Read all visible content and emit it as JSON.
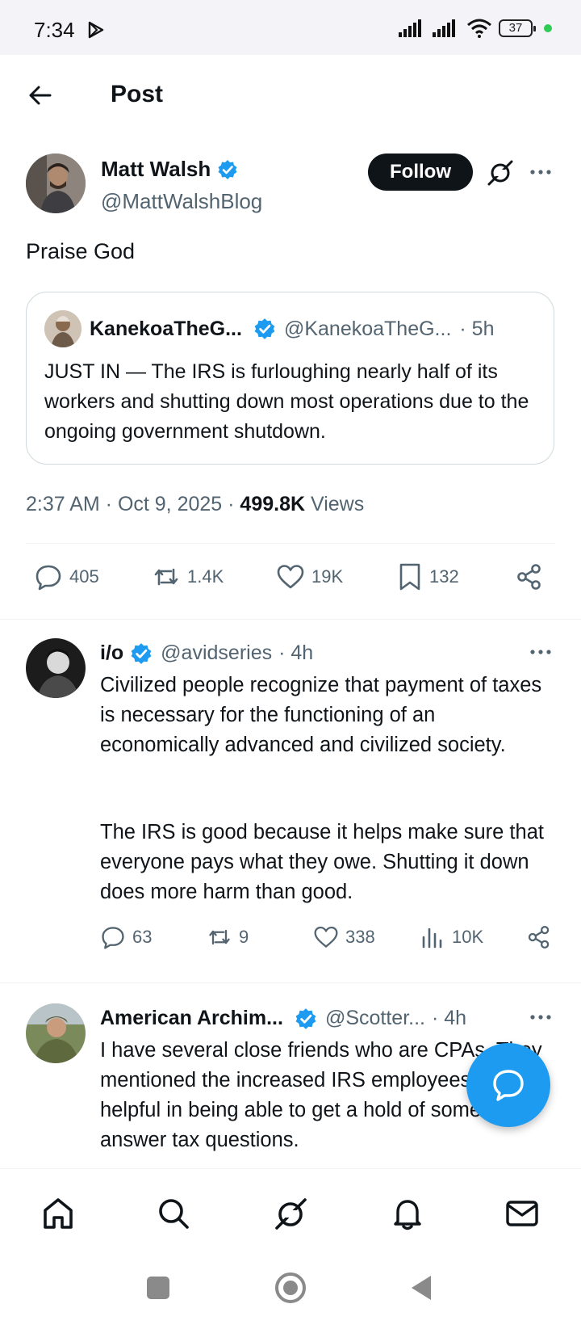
{
  "status_bar": {
    "time": "7:34",
    "battery": "37"
  },
  "header": {
    "title": "Post"
  },
  "main_tweet": {
    "author_name": "Matt Walsh",
    "handle": "@MattWalshBlog",
    "follow_label": "Follow",
    "text": "Praise God",
    "quote": {
      "author_name": "KanekoaTheG...",
      "handle": "@KanekoaTheG...",
      "time": "· 5h",
      "text": "JUST IN — The IRS is furloughing nearly half of its workers and shutting down most operations due to the ongoing government shutdown."
    },
    "timestamp": "2:37 AM · Oct 9, 2025 ·",
    "views_count": "499.8K",
    "views_label": "Views",
    "stats": {
      "replies": "405",
      "reposts": "1.4K",
      "likes": "19K",
      "bookmarks": "132"
    }
  },
  "replies": [
    {
      "author_name": "i/o",
      "handle": "@avidseries",
      "time": "· 4h",
      "text_p1": "Civilized people recognize that payment of taxes is necessary for the functioning of an economically advanced and civilized society.",
      "text_p2": "The IRS is good because it helps make sure that everyone pays what they owe. Shutting it down does more harm than good.",
      "stats": {
        "replies": "63",
        "reposts": "9",
        "likes": "338",
        "views": "10K"
      }
    },
    {
      "author_name": "American Archim...",
      "handle": "@Scotter...",
      "time": "· 4h",
      "text": "I have several close friends who are CPAs. They mentioned the increased IRS employees were helpful in being able to get a hold of someone to answer tax questions."
    }
  ],
  "icons": {
    "back": "arrow-left-icon",
    "grok": "grok-icon",
    "more": "more-icon",
    "reply": "reply-icon",
    "repost": "repost-icon",
    "like": "heart-icon",
    "bookmark": "bookmark-icon",
    "share": "share-icon",
    "views": "views-icon",
    "home": "home-icon",
    "search": "search-icon",
    "notifications": "bell-icon",
    "messages": "mail-icon",
    "compose": "chat-bubble-icon"
  },
  "colors": {
    "verified": "#1d9bf0",
    "accent": "#1d9bf0",
    "text": "#0f1419",
    "muted": "#536471"
  }
}
